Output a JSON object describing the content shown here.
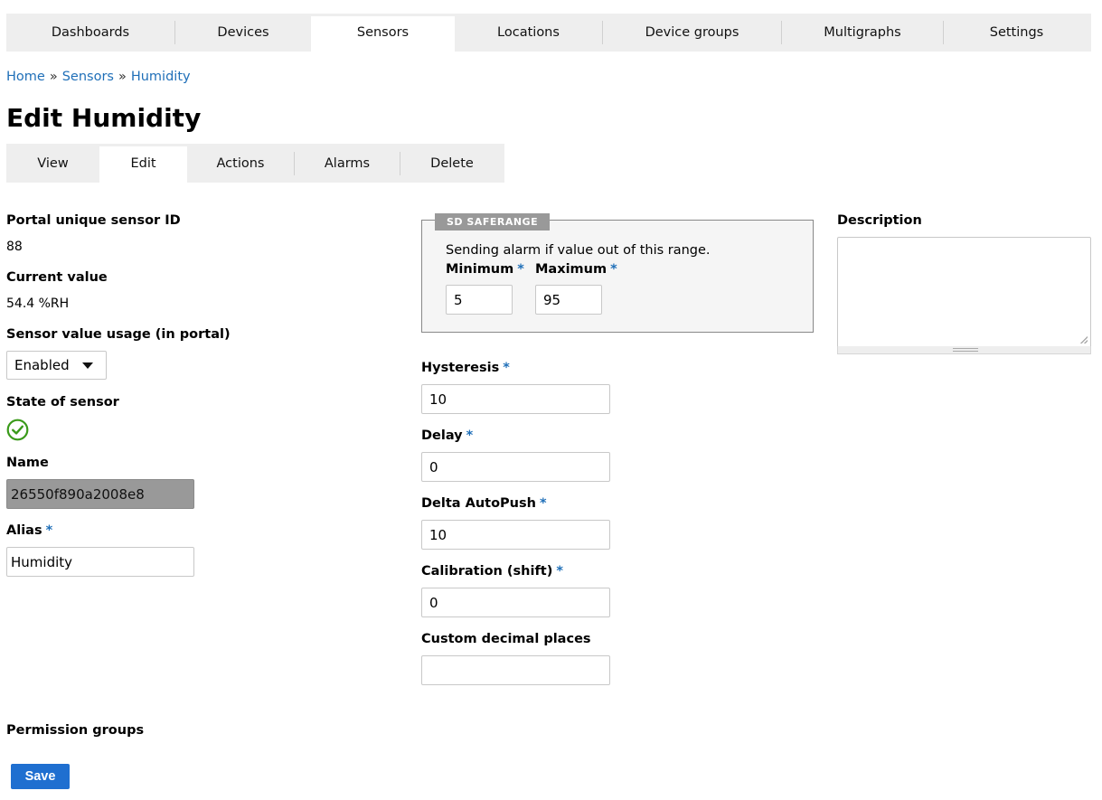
{
  "topnav": {
    "tabs": [
      {
        "label": "Dashboards",
        "active": false
      },
      {
        "label": "Devices",
        "active": false
      },
      {
        "label": "Sensors",
        "active": true
      },
      {
        "label": "Locations",
        "active": false
      },
      {
        "label": "Device groups",
        "active": false
      },
      {
        "label": "Multigraphs",
        "active": false
      },
      {
        "label": "Settings",
        "active": false
      }
    ]
  },
  "breadcrumb": {
    "home": "Home",
    "sensors": "Sensors",
    "current": "Humidity",
    "separator": "»"
  },
  "page": {
    "title": "Edit Humidity"
  },
  "subnav": {
    "tabs": [
      {
        "label": "View",
        "active": false
      },
      {
        "label": "Edit",
        "active": true
      },
      {
        "label": "Actions",
        "active": false
      },
      {
        "label": "Alarms",
        "active": false
      },
      {
        "label": "Delete",
        "active": false
      }
    ]
  },
  "form": {
    "required_mark": "*",
    "sensor_id": {
      "label": "Portal unique sensor ID",
      "value": "88"
    },
    "current_value": {
      "label": "Current value",
      "value": "54.4 %RH"
    },
    "usage": {
      "label": "Sensor value usage (in portal)",
      "selected": "Enabled"
    },
    "state": {
      "label": "State of sensor",
      "icon": "check-circle-icon",
      "color": "#3a9a1a"
    },
    "name": {
      "label": "Name",
      "value": "26550f890a2008e8"
    },
    "alias": {
      "label": "Alias",
      "value": "Humidity"
    },
    "saferange": {
      "legend": "SD SAFERANGE",
      "description": "Sending alarm if value out of this range.",
      "minimum_label": "Minimum",
      "minimum_value": "5",
      "maximum_label": "Maximum",
      "maximum_value": "95"
    },
    "hysteresis": {
      "label": "Hysteresis",
      "value": "10"
    },
    "delay": {
      "label": "Delay",
      "value": "0"
    },
    "delta_autopush": {
      "label": "Delta AutoPush",
      "value": "10"
    },
    "calibration": {
      "label": "Calibration (shift)",
      "value": "0"
    },
    "decimal_places": {
      "label": "Custom decimal places",
      "value": ""
    },
    "description": {
      "label": "Description",
      "value": ""
    },
    "permission_groups": {
      "label": "Permission groups"
    },
    "save_label": "Save"
  },
  "colors": {
    "accent": "#1f6fb8",
    "button": "#1f6fd0",
    "nav_bg": "#eeeeee",
    "legend_bg": "#999999"
  }
}
